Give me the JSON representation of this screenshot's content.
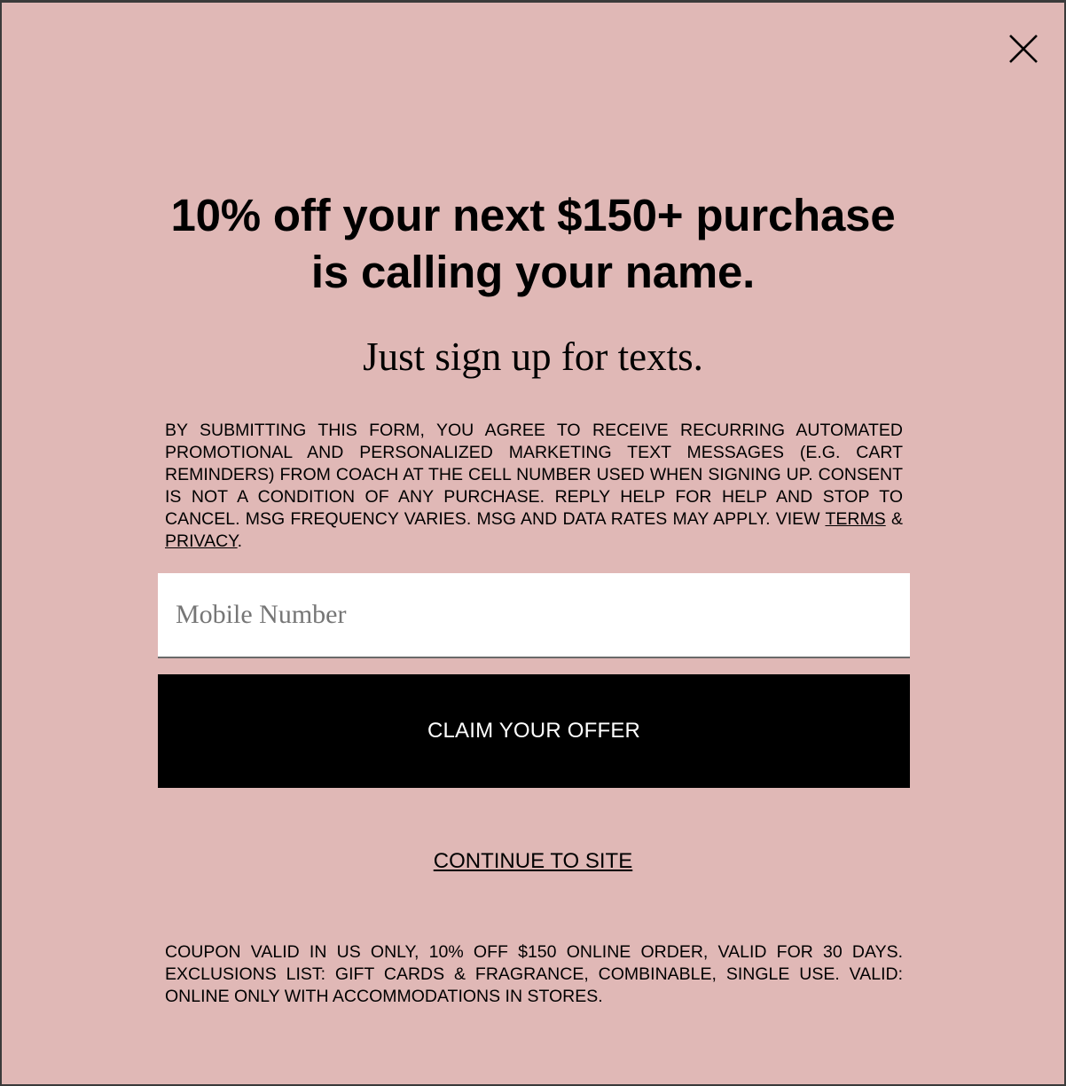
{
  "modal": {
    "close_icon": "close-icon",
    "headline_line1": "10% off your next $150+ purchase",
    "headline_line2": "is calling your name.",
    "subhead": "Just sign up for texts.",
    "disclaimer": {
      "text": "BY SUBMITTING THIS FORM, YOU AGREE TO RECEIVE RECURRING AUTOMATED PROMOTIONAL AND PERSONALIZED MARKETING TEXT MESSAGES (E.G. CART REMINDERS) FROM COACH AT THE CELL NUMBER USED WHEN SIGNING UP. CONSENT IS NOT A CONDITION OF ANY PURCHASE. REPLY HELP FOR HELP AND STOP TO CANCEL. MSG FREQUENCY VARIES. MSG AND DATA RATES MAY APPLY. VIEW",
      "terms_link": "TERMS",
      "ampersand": "&",
      "privacy_link": "PRIVACY",
      "end": "."
    },
    "phone_input": {
      "placeholder": "Mobile Number",
      "value": ""
    },
    "claim_button": "CLAIM YOUR OFFER",
    "continue_link": "CONTINUE TO SITE",
    "coupon_terms": "COUPON VALID IN US ONLY, 10% OFF $150 ONLINE ORDER, VALID FOR 30 DAYS. EXCLUSIONS LIST: GIFT CARDS & FRAGRANCE, COMBINABLE, SINGLE USE. VALID: ONLINE ONLY WITH ACCOMMODATIONS IN STORES."
  },
  "colors": {
    "modal_background": "#e0b8b6",
    "button_background": "#000000",
    "button_text": "#ffffff",
    "input_background": "#ffffff"
  }
}
